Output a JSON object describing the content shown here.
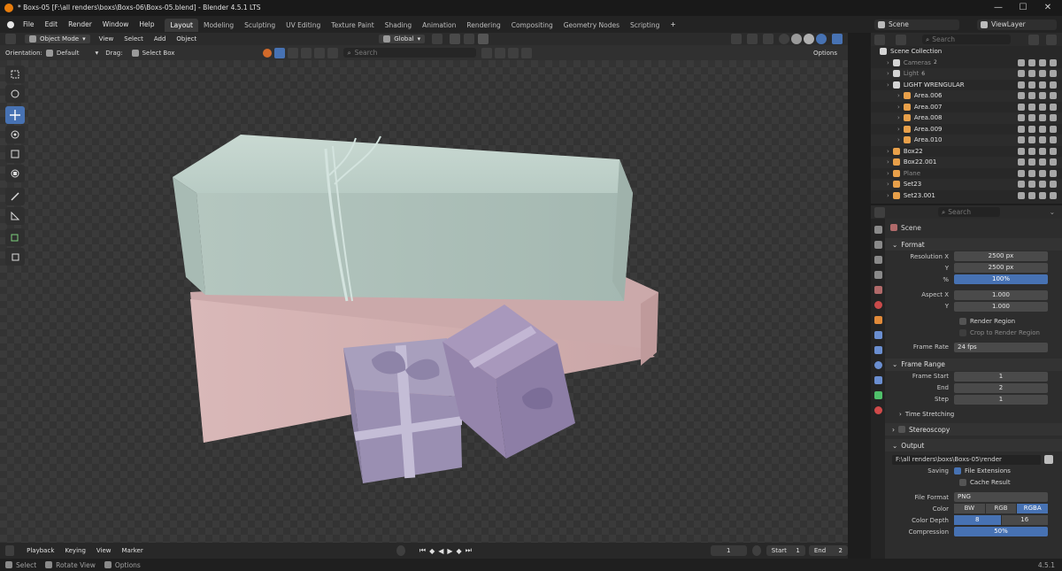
{
  "window": {
    "title": "* Boxs-05 [F:\\all renders\\boxs\\Boxs-06\\Boxs-05.blend] - Blender 4.5.1 LTS",
    "minimize": "—",
    "maximize": "☐",
    "close": "✕"
  },
  "menu": {
    "items": [
      "File",
      "Edit",
      "Render",
      "Window",
      "Help"
    ]
  },
  "workspaces": {
    "tabs": [
      "Layout",
      "Modeling",
      "Sculpting",
      "UV Editing",
      "Texture Paint",
      "Shading",
      "Animation",
      "Rendering",
      "Compositing",
      "Geometry Nodes",
      "Scripting"
    ],
    "active_index": 0,
    "add": "+"
  },
  "scene_selector": {
    "scene": "Scene",
    "view_layer": "ViewLayer"
  },
  "viewport_header": {
    "mode": "Object Mode",
    "menus": [
      "View",
      "Select",
      "Add",
      "Object"
    ],
    "transform_orientation": "Global",
    "orientation_label": "Orientation:",
    "orientation_value": "Default",
    "drag_label": "Drag:",
    "drag_value": "Select Box",
    "search_placeholder": "Search",
    "options": "Options"
  },
  "tools": [
    "select-box-tool",
    "cursor-tool",
    "move-tool",
    "rotate-tool",
    "scale-tool",
    "transform-tool",
    "annotate-tool",
    "measure-tool",
    "add-cube-tool",
    "add-object-tool"
  ],
  "active_tool": 2,
  "timeline": {
    "menus": [
      "Playback",
      "Keying",
      "View",
      "Marker"
    ],
    "current_frame": "1",
    "start_label": "Start",
    "start": "1",
    "end_label": "End",
    "end": "2"
  },
  "statusbar": {
    "select": "Select",
    "rotate_view": "Rotate View",
    "options": "Options",
    "version": "4.5.1"
  },
  "outliner": {
    "search_placeholder": "Search",
    "root": "Scene Collection",
    "rows": [
      {
        "name": "Cameras",
        "depth": 1,
        "icon_color": "#d4d4d4",
        "dim": true,
        "badge": "2"
      },
      {
        "name": "Light",
        "depth": 1,
        "icon_color": "#d4d4d4",
        "dim": true,
        "badge": "6"
      },
      {
        "name": "LIGHT WRENGULAR",
        "depth": 1,
        "icon_color": "#d4d4d4",
        "dim": false,
        "badge": ""
      },
      {
        "name": "Area.006",
        "depth": 2,
        "icon_color": "#e8a04a",
        "dim": false,
        "badge": ""
      },
      {
        "name": "Area.007",
        "depth": 2,
        "icon_color": "#e8a04a",
        "dim": false,
        "badge": ""
      },
      {
        "name": "Area.008",
        "depth": 2,
        "icon_color": "#e8a04a",
        "dim": false,
        "badge": ""
      },
      {
        "name": "Area.009",
        "depth": 2,
        "icon_color": "#e8a04a",
        "dim": false,
        "badge": ""
      },
      {
        "name": "Area.010",
        "depth": 2,
        "icon_color": "#e8a04a",
        "dim": false,
        "badge": ""
      },
      {
        "name": "Box22",
        "depth": 1,
        "icon_color": "#e8a04a",
        "dim": false,
        "badge": ""
      },
      {
        "name": "Box22.001",
        "depth": 1,
        "icon_color": "#e8a04a",
        "dim": false,
        "badge": ""
      },
      {
        "name": "Plane",
        "depth": 1,
        "icon_color": "#e8a04a",
        "dim": true,
        "badge": ""
      },
      {
        "name": "Set23",
        "depth": 1,
        "icon_color": "#e8a04a",
        "dim": false,
        "badge": ""
      },
      {
        "name": "Set23.001",
        "depth": 1,
        "icon_color": "#e8a04a",
        "dim": false,
        "badge": ""
      }
    ]
  },
  "properties": {
    "search_placeholder": "Search",
    "context": "Scene",
    "format": {
      "title": "Format",
      "resolution_x_label": "Resolution X",
      "resolution_x": "2500 px",
      "resolution_y_label": "Y",
      "resolution_y": "2500 px",
      "percent_label": "%",
      "percent": "100%",
      "aspect_x_label": "Aspect X",
      "aspect_x": "1.000",
      "aspect_y_label": "Y",
      "aspect_y": "1.000",
      "render_region": "Render Region",
      "crop_region": "Crop to Render Region",
      "frame_rate_label": "Frame Rate",
      "frame_rate": "24 fps"
    },
    "frame_range": {
      "title": "Frame Range",
      "start_label": "Frame Start",
      "start": "1",
      "end_label": "End",
      "end": "2",
      "step_label": "Step",
      "step": "1",
      "time_stretching": "Time Stretching"
    },
    "stereoscopy": "Stereoscopy",
    "output": {
      "title": "Output",
      "path": "F:\\all renders\\boxs\\Boxs-05\\render",
      "saving_label": "Saving",
      "file_extensions": "File Extensions",
      "cache_result": "Cache Result",
      "file_format_label": "File Format",
      "file_format": "PNG",
      "color_label": "Color",
      "color_options": [
        "BW",
        "RGB",
        "RGBA"
      ],
      "color_selected": 2,
      "color_depth_label": "Color Depth",
      "depth_options": [
        "8",
        "16"
      ],
      "depth_selected": 0,
      "compression_label": "Compression",
      "compression": "50%"
    }
  },
  "colors": {
    "accent": "#4772b3",
    "viewport_bg": "#393939",
    "panel_bg": "#2d2d2d"
  }
}
